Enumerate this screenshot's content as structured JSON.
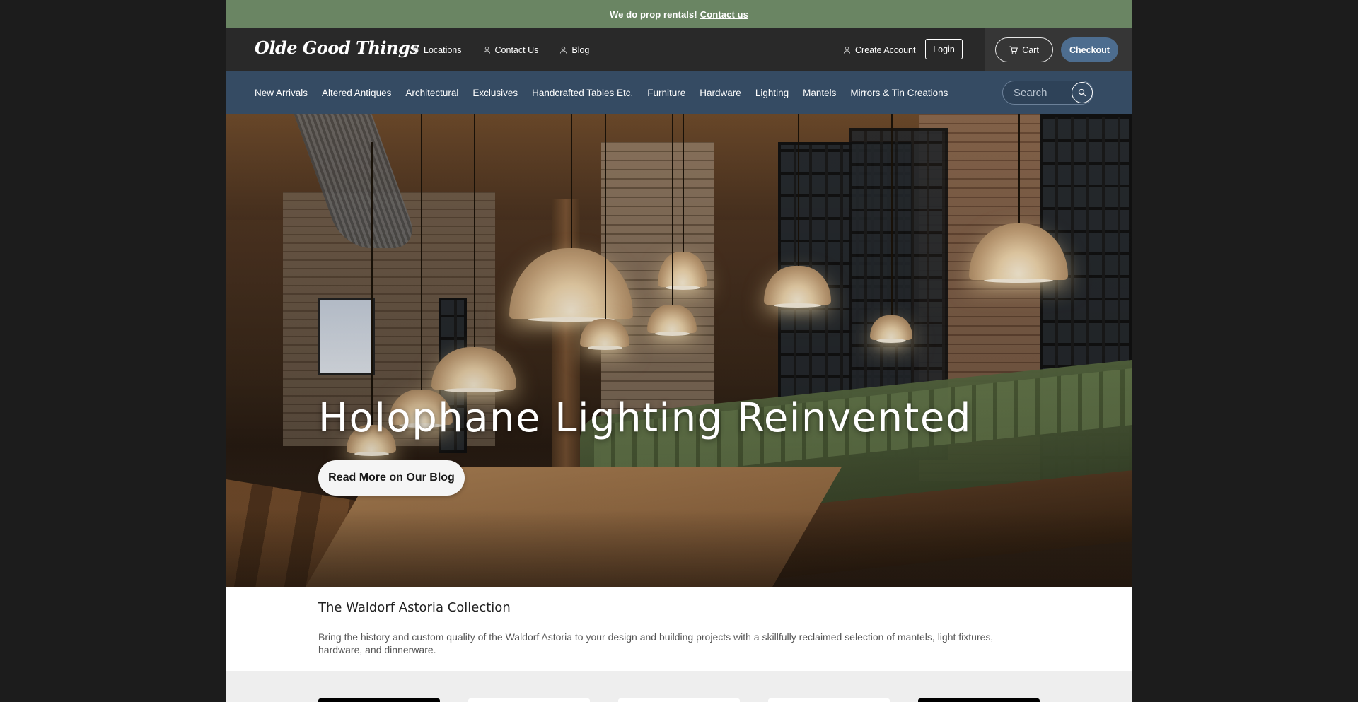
{
  "promo": {
    "text": "We do prop rentals!",
    "link": "Contact us"
  },
  "header": {
    "logo": "Olde Good Things",
    "links": [
      {
        "label": "Locations",
        "icon": "location-pin-icon"
      },
      {
        "label": "Contact Us",
        "icon": "user-icon"
      },
      {
        "label": "Blog",
        "icon": "user-icon"
      }
    ],
    "create_account": "Create Account",
    "login": "Login",
    "cart": "Cart",
    "checkout": "Checkout"
  },
  "nav": {
    "categories": [
      "New Arrivals",
      "Altered Antiques",
      "Architectural",
      "Exclusives",
      "Handcrafted Tables Etc.",
      "Furniture",
      "Hardware",
      "Lighting",
      "Mantels",
      "Mirrors & Tin Creations"
    ],
    "search_placeholder": "Search"
  },
  "hero": {
    "title": "Holophane Lighting Reinvented",
    "button": "Read More on Our Blog"
  },
  "collection": {
    "title": "The Waldorf Astoria Collection",
    "description": "Bring the history and custom quality of the Waldorf Astoria to your design and building projects with a skillfully reclaimed selection of mantels, light fixtures, hardware, and dinnerware."
  },
  "colors": {
    "promo_bg": "#6a8563",
    "header_bg": "#292929",
    "nav_bg": "#354b63",
    "checkout_bg": "#4d6d8f"
  }
}
